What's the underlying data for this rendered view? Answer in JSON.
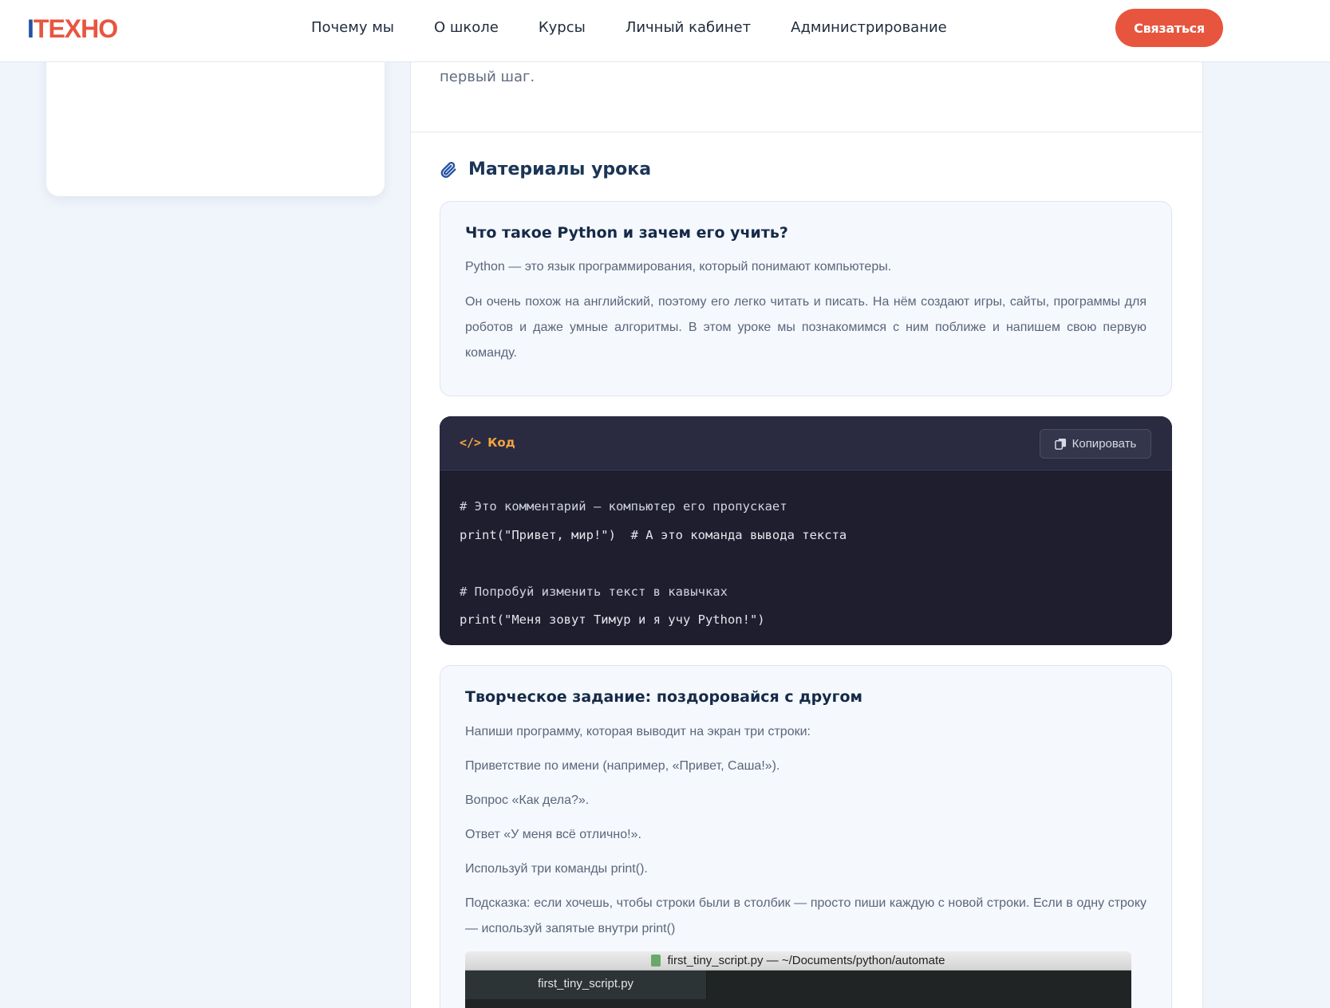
{
  "header": {
    "logo_i": "I",
    "logo_rest": "TEXHO",
    "nav": [
      "Почему мы",
      "О школе",
      "Курсы",
      "Личный кабинет",
      "Администрирование"
    ],
    "contact_label": "Связаться"
  },
  "main": {
    "intro_tail": "первый шаг.",
    "section_title": "Материалы урока",
    "section_icon": "paperclip-icon",
    "card1": {
      "title": "Что такое Python и зачем его учить?",
      "p1": "Python — это язык программирования, который понимают компьютеры.",
      "p2": "Он очень похож на английский, поэтому его легко читать и писать. На нём создают игры, сайты, программы для роботов и даже умные алгоритмы. В этом уроке мы познакомимся с ним поближе и напишем свою первую команду."
    },
    "code": {
      "label": "Код",
      "icon": "</>",
      "copy_label": "Копировать",
      "lines": [
        "# Это комментарий — компьютер его пропускает",
        "print(\"Привет, мир!\")  # А это команда вывода текста",
        "",
        "# Попробуй изменить текст в кавычках",
        "print(\"Меня зовут Тимур и я учу Python!\")"
      ]
    },
    "card3": {
      "title": "Творческое задание: поздоровайся с другом",
      "p1": "Напиши программу, которая выводит на экран три строки:",
      "p2": "Приветствие по имени (например, «Привет, Саша!»).",
      "p3": "Вопрос «Как дела?».",
      "p4": "Ответ «У меня всё отлично!».",
      "p5": "Используй три команды print().",
      "p6": "Подсказка: если хочешь, чтобы строки были в столбик — просто пиши каждую с новой строки. Если в одну строку — используй запятые внутри print()",
      "embed_title": "first_tiny_script.py — ~/Documents/python/automate",
      "embed_tab": "first_tiny_script.py"
    }
  },
  "colors": {
    "accent": "#e8553f",
    "brand_blue": "#2452a3",
    "code_bg": "#1e1e2e",
    "code_label": "#f4a340"
  }
}
